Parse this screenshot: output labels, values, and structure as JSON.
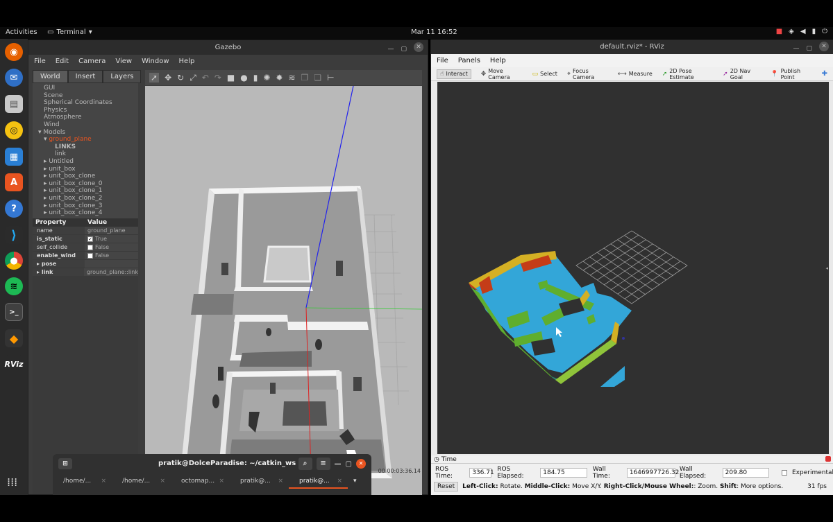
{
  "topbar": {
    "activities": "Activities",
    "app_name": "Terminal",
    "clock": "Mar 11  16:52"
  },
  "dock": {
    "items": [
      "firefox-icon",
      "thunderbird-icon",
      "files-icon",
      "rhythmbox-icon",
      "writer-icon",
      "software-icon",
      "help-icon",
      "vscode-icon",
      "chrome-icon",
      "spotify-icon",
      "terminal-icon",
      "sublime-icon",
      "rviz-icon"
    ],
    "rviz_label": "RViz"
  },
  "gazebo": {
    "title": "Gazebo",
    "menu": [
      "File",
      "Edit",
      "Camera",
      "View",
      "Window",
      "Help"
    ],
    "tabs": [
      "World",
      "Insert",
      "Layers"
    ],
    "tree": [
      {
        "label": "GUI",
        "indent": 0,
        "arrow": ""
      },
      {
        "label": "Scene",
        "indent": 0,
        "arrow": ""
      },
      {
        "label": "Spherical Coordinates",
        "indent": 0,
        "arrow": ""
      },
      {
        "label": "Physics",
        "indent": 0,
        "arrow": ""
      },
      {
        "label": "Atmosphere",
        "indent": 0,
        "arrow": ""
      },
      {
        "label": "Wind",
        "indent": 0,
        "arrow": ""
      },
      {
        "label": "Models",
        "indent": 0,
        "arrow": "▾"
      },
      {
        "label": "ground_plane",
        "indent": 1,
        "arrow": "▾",
        "highlight": true
      },
      {
        "label": "LINKS",
        "indent": 2,
        "arrow": "",
        "bold": true
      },
      {
        "label": "link",
        "indent": 2,
        "arrow": ""
      },
      {
        "label": "Untitled",
        "indent": 1,
        "arrow": "▸"
      },
      {
        "label": "unit_box",
        "indent": 1,
        "arrow": "▸"
      },
      {
        "label": "unit_box_clone",
        "indent": 1,
        "arrow": "▸"
      },
      {
        "label": "unit_box_clone_0",
        "indent": 1,
        "arrow": "▸"
      },
      {
        "label": "unit_box_clone_1",
        "indent": 1,
        "arrow": "▸"
      },
      {
        "label": "unit_box_clone_2",
        "indent": 1,
        "arrow": "▸"
      },
      {
        "label": "unit_box_clone_3",
        "indent": 1,
        "arrow": "▸"
      },
      {
        "label": "unit_box_clone_4",
        "indent": 1,
        "arrow": "▸"
      }
    ],
    "props_header": {
      "property": "Property",
      "value": "Value"
    },
    "props": [
      {
        "key": "name",
        "value": "ground_plane",
        "check": false,
        "bold": false
      },
      {
        "key": "is_static",
        "value": "True",
        "check": true,
        "checked": true,
        "bold": true
      },
      {
        "key": "self_collide",
        "value": "False",
        "check": true,
        "checked": false,
        "bold": false
      },
      {
        "key": "enable_wind",
        "value": "False",
        "check": true,
        "checked": false,
        "bold": true
      },
      {
        "key": "pose",
        "value": "",
        "check": false,
        "bold": true,
        "arrow": "▸"
      },
      {
        "key": "link",
        "value": "ground_plane::link",
        "check": false,
        "bold": true,
        "arrow": "▸"
      }
    ],
    "sim_time": "00 00:03:36.14"
  },
  "terminal": {
    "title": "pratik@DolceParadise: ~/catkin_ws",
    "tabs": [
      "/home/...",
      "/home/...",
      "octomap...",
      "pratik@...",
      "pratik@..."
    ]
  },
  "rviz": {
    "title": "default.rviz* - RViz",
    "menu": [
      "File",
      "Panels",
      "Help"
    ],
    "tools": [
      "Interact",
      "Move Camera",
      "Select",
      "Focus Camera",
      "Measure",
      "2D Pose Estimate",
      "2D Nav Goal",
      "Publish Point"
    ],
    "time": {
      "panel_title": "Time",
      "ros_time_label": "ROS Time:",
      "ros_time": "336.71",
      "ros_elapsed_label": "ROS Elapsed:",
      "ros_elapsed": "184.75",
      "wall_time_label": "Wall Time:",
      "wall_time": "1646997726.32",
      "wall_elapsed_label": "Wall Elapsed:",
      "wall_elapsed": "209.80",
      "experimental": "Experimental"
    },
    "status": {
      "reset": "Reset",
      "left_click": "Left-Click:",
      "left_click_desc": " Rotate. ",
      "middle_click": "Middle-Click:",
      "middle_click_desc": " Move X/Y. ",
      "right_click": "Right-Click/Mouse Wheel:",
      "right_click_desc": ": Zoom. ",
      "shift": "Shift",
      "shift_desc": ": More options.",
      "fps": "31 fps"
    }
  },
  "colors": {
    "ubuntu_orange": "#e95420",
    "octomap_blue": "#33a6d8",
    "octomap_green": "#5fae2e"
  }
}
